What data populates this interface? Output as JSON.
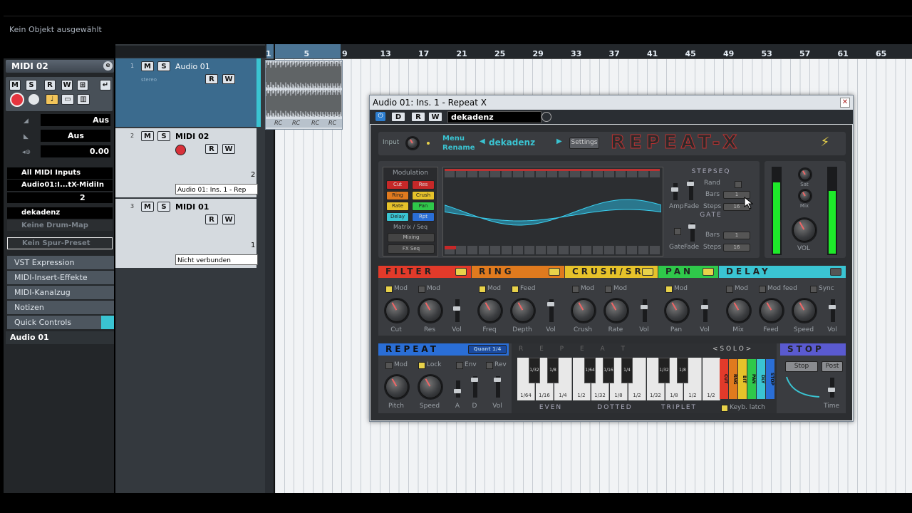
{
  "info_bar": {
    "text": "Kein Objekt ausgewählt"
  },
  "inspector": {
    "track_name": "MIDI 02",
    "volume_label": "Aus",
    "pan_label": "Aus",
    "transpose_value": "0.00",
    "input": "All MIDI Inputs",
    "output": "Audio01:I...tX-MidiIn",
    "channel": "2",
    "program": "dekadenz",
    "drum_map": "Keine Drum-Map",
    "preset": "Kein Spur-Preset",
    "sections": [
      "VST Expression",
      "MIDI-Insert-Effekte",
      "MIDI-Kanalzug",
      "Notizen",
      "Quick Controls"
    ],
    "bottom_track": "Audio 01"
  },
  "tracks": [
    {
      "num": "1",
      "name": "Audio 01",
      "sub": "stereo"
    },
    {
      "num": "2",
      "name": "MIDI 02",
      "routing": "Audio 01: Ins. 1 - Rep",
      "channel": "2"
    },
    {
      "num": "3",
      "name": "MIDI 01",
      "routing": "Nicht verbunden",
      "channel": "1"
    }
  ],
  "ruler": {
    "marks": [
      "1",
      "5",
      "9",
      "13",
      "17",
      "21",
      "25",
      "29",
      "33",
      "37",
      "41",
      "45",
      "49",
      "53",
      "57",
      "61",
      "65"
    ]
  },
  "clip_label": "RC",
  "plugin": {
    "window_title": "Audio 01: Ins. 1 - Repeat X",
    "preset_field": "dekadenz",
    "input_label": "Input",
    "menu_label": "Menu",
    "rename_label": "Rename",
    "preset_name": "dekadenz",
    "settings_label": "Settings",
    "logo": "REPEAT-X",
    "modulation": {
      "title": "Modulation",
      "buttons": [
        "Cut",
        "Res",
        "Ring",
        "Crush",
        "Rate",
        "Pan",
        "Delay",
        "Rpt"
      ],
      "matrix_label": "Matrix / Seq",
      "mixing": "Mixing",
      "fx_seq": "FX Seq"
    },
    "stepseq": {
      "title": "STEPSEQ",
      "rand": "Rand",
      "amp": "Amp",
      "fade": "Fade",
      "bars": "Bars",
      "steps": "Steps",
      "bars_val": "1",
      "steps_val": "16"
    },
    "gate": {
      "title": "GATE",
      "gate": "Gate",
      "fade": "Fade",
      "bars": "Bars",
      "steps": "Steps",
      "bars_val": "1",
      "steps_val": "16"
    },
    "output": {
      "sat": "Sat",
      "mix": "Mix",
      "vol": "VOL"
    },
    "filter": {
      "title": "FILTER",
      "mod1": "Mod",
      "mod2": "Mod",
      "knob1": "Cut",
      "knob2": "Res",
      "fader": "Vol"
    },
    "ring": {
      "title": "RING",
      "mod": "Mod",
      "feed": "Feed",
      "knob1": "Freq",
      "knob2": "Depth",
      "fader": "Vol"
    },
    "crush": {
      "title": "CRUSH/SR",
      "mod1": "Mod",
      "mod2": "Mod",
      "knob1": "Crush",
      "knob2": "Rate",
      "fader": "Vol"
    },
    "pan": {
      "title": "PAN",
      "mod": "Mod",
      "knob1": "Pan",
      "fader": "Vol"
    },
    "delay": {
      "title": "DELAY",
      "mod": "Mod",
      "modfeed": "Mod feed",
      "sync": "Sync",
      "knob1": "Mix",
      "knob2": "Feed",
      "knob3": "Speed",
      "fader": "Vol"
    },
    "repeat": {
      "title": "REPEAT",
      "quant": "Quant 1/4",
      "mod": "Mod",
      "lock": "Lock",
      "env": "Env",
      "rev": "Rev",
      "knob1": "Pitch",
      "knob2": "Speed",
      "fader1": "A",
      "fader2": "D",
      "fader3": "Vol"
    },
    "keyboard": {
      "header": "R E P E A T",
      "solo": "< S O L O >",
      "even": "EVEN",
      "dotted": "DOTTED",
      "triplet": "TRIPLET",
      "keyb_latch": "Keyb. latch",
      "white_keys": [
        "1/64",
        "1/16",
        "1/4",
        "1/2",
        "1/32",
        "1/8",
        "1/2",
        "1/32",
        "1/8",
        "1/2",
        "1/2"
      ],
      "black_keys": [
        "1/32",
        "1/8",
        "1/64",
        "1/16",
        "1/4",
        "1/32",
        "1/8"
      ],
      "fx_keys": [
        "CUT",
        "RNG",
        "BIT",
        "PAN",
        "DLY",
        "STOP"
      ]
    },
    "stop": {
      "title": "STOP",
      "stop_btn": "Stop",
      "post_btn": "Post",
      "time": "Time"
    }
  },
  "colors": {
    "filter": "#e23a2a",
    "ring": "#e07a1e",
    "crush": "#e6c22a",
    "pan": "#2fc84a",
    "delay": "#3ac4d2",
    "repeat": "#2a6ed6",
    "stop": "#5a5ad0",
    "wave": "#2ab4d8",
    "meter": "#1eea2a"
  }
}
